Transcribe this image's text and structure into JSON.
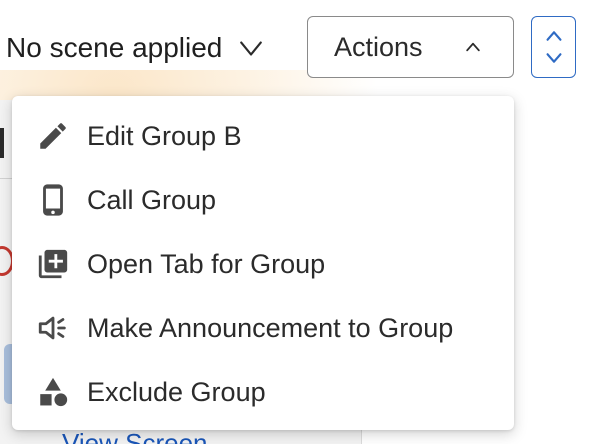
{
  "toolbar": {
    "scene_label": "No scene applied",
    "actions_label": "Actions"
  },
  "background": {
    "link_text": "View Screen"
  },
  "actions_menu": {
    "items": [
      {
        "label": "Edit Group B",
        "icon": "pencil-icon"
      },
      {
        "label": "Call Group",
        "icon": "phone-icon"
      },
      {
        "label": "Open Tab for Group",
        "icon": "add-tab-icon"
      },
      {
        "label": "Make Announcement to Group",
        "icon": "announcement-icon"
      },
      {
        "label": "Exclude Group",
        "icon": "shapes-icon"
      }
    ]
  },
  "colors": {
    "accent": "#2f6bc4",
    "text": "#2b2b2b",
    "icon": "#4a4a4a"
  }
}
